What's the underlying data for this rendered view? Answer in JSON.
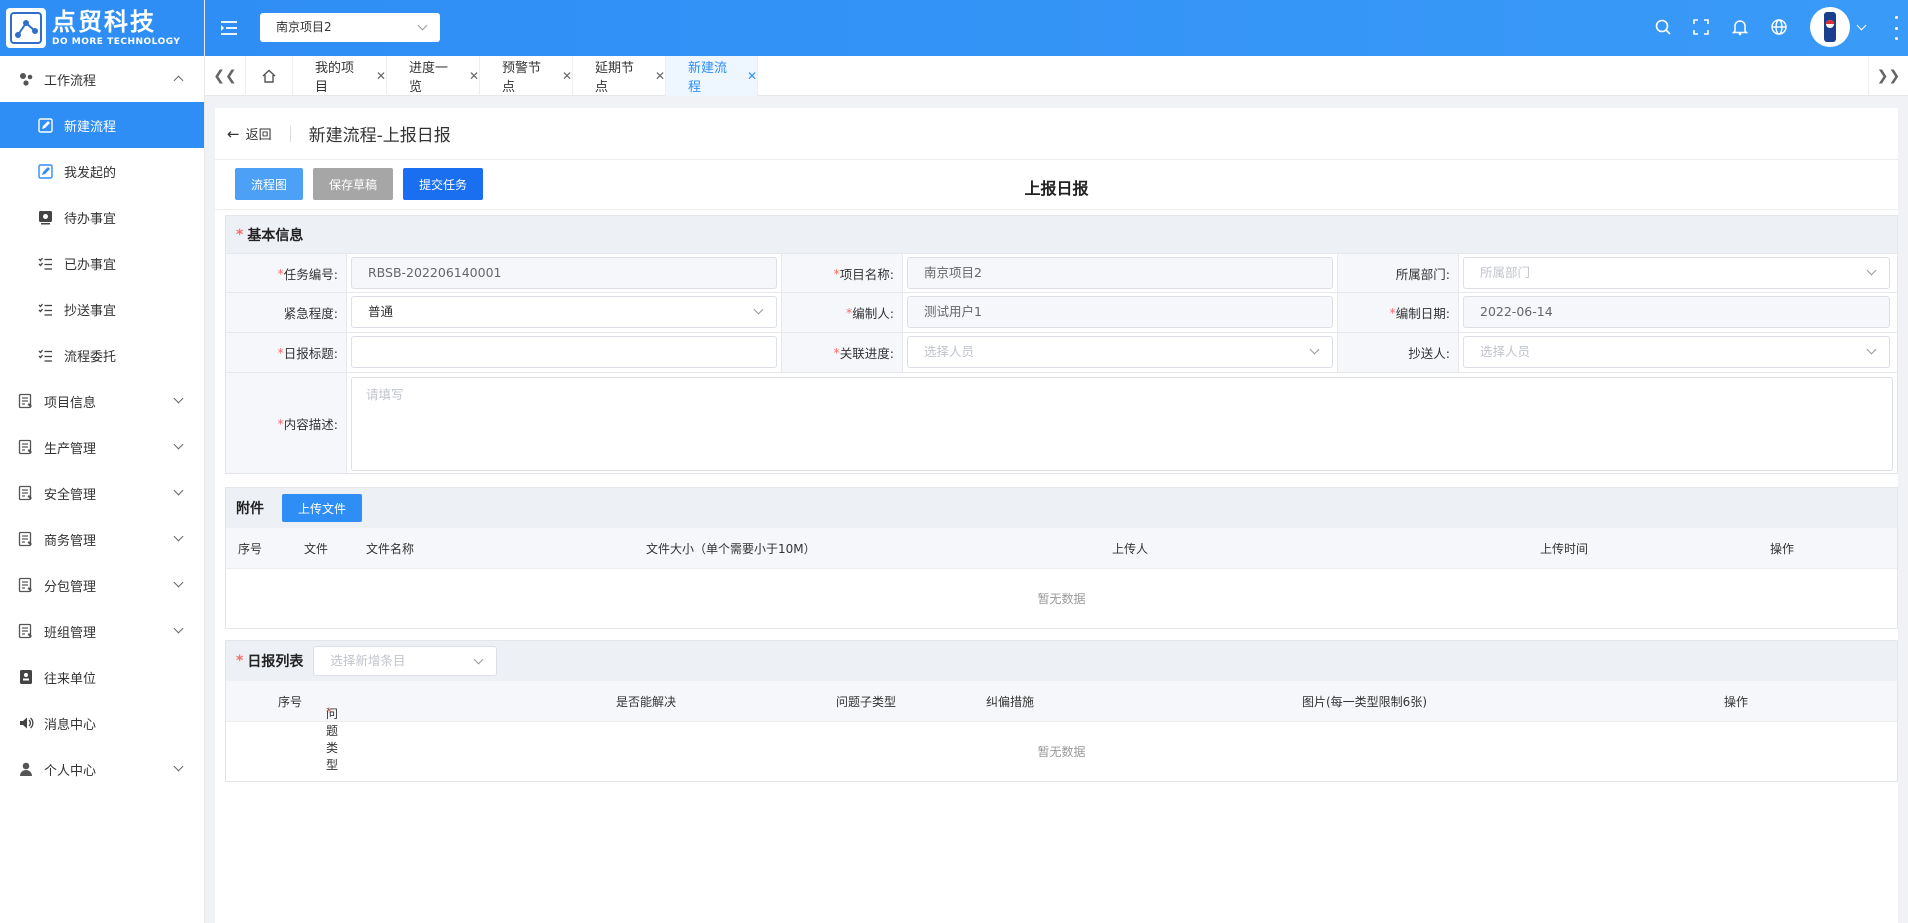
{
  "brand": {
    "name_cn": "点贸科技",
    "name_en": "DO MORE TECHNOLOGY"
  },
  "sidebar": {
    "items": [
      {
        "label": "工作流程",
        "icon": "workflow-icon",
        "expanded": true
      },
      {
        "label": "新建流程",
        "icon": "edit-icon",
        "sub": true,
        "active": true
      },
      {
        "label": "我发起的",
        "icon": "edit-icon",
        "sub": true
      },
      {
        "label": "待办事宜",
        "icon": "todo-icon",
        "sub": true
      },
      {
        "label": "已办事宜",
        "icon": "list-icon",
        "sub": true
      },
      {
        "label": "抄送事宜",
        "icon": "list-icon",
        "sub": true
      },
      {
        "label": "流程委托",
        "icon": "list-icon",
        "sub": true
      },
      {
        "label": "项目信息",
        "icon": "document-icon"
      },
      {
        "label": "生产管理",
        "icon": "document-icon"
      },
      {
        "label": "安全管理",
        "icon": "document-icon"
      },
      {
        "label": "商务管理",
        "icon": "document-icon"
      },
      {
        "label": "分包管理",
        "icon": "document-icon"
      },
      {
        "label": "班组管理",
        "icon": "document-icon"
      },
      {
        "label": "往来单位",
        "icon": "contacts-icon"
      },
      {
        "label": "消息中心",
        "icon": "speaker-icon"
      },
      {
        "label": "个人中心",
        "icon": "user-icon"
      }
    ]
  },
  "header": {
    "project": "南京项目2"
  },
  "tabs": [
    {
      "label": "我的项目"
    },
    {
      "label": "进度一览"
    },
    {
      "label": "预警节点"
    },
    {
      "label": "延期节点"
    },
    {
      "label": "新建流程",
      "active": true
    }
  ],
  "page": {
    "back": "返回",
    "title": "新建流程-上报日报"
  },
  "toolbar": {
    "flow_btn": "流程图",
    "draft_btn": "保存草稿",
    "submit_btn": "提交任务",
    "form_title": "上报日报"
  },
  "basic": {
    "title": "基本信息",
    "task_no_label": "任务编号:",
    "task_no": "RBSB-202206140001",
    "project_label": "项目名称:",
    "project": "南京项目2",
    "dept_label": "所属部门:",
    "dept_ph": "所属部门",
    "urgency_label": "紧急程度:",
    "urgency": "普通",
    "editor_label": "编制人:",
    "editor": "测试用户1",
    "date_label": "编制日期:",
    "date": "2022-06-14",
    "report_title_label": "日报标题:",
    "progress_label": "关联进度:",
    "progress_ph": "选择人员",
    "cc_label": "抄送人:",
    "cc_ph": "选择人员",
    "desc_label": "内容描述:",
    "desc_ph": "请填写"
  },
  "attachments": {
    "title": "附件",
    "upload_btn": "上传文件",
    "cols": [
      "序号",
      "文件",
      "文件名称",
      "文件大小（单个需要小于10M）",
      "上传人",
      "上传时间",
      "操作"
    ],
    "empty": "暂无数据"
  },
  "report_list": {
    "title": "日报列表",
    "select_ph": "选择新增条目",
    "cols": [
      "序号",
      "问题类型",
      "是否能解决",
      "问题子类型",
      "纠偏措施",
      "图片(每一类型限制6张)",
      "操作"
    ],
    "empty": "暂无数据"
  },
  "colors": {
    "primary": "#2f8ef5",
    "submit": "#1a6ff0",
    "draft": "#a6a6a6",
    "required": "#f56c6c"
  }
}
